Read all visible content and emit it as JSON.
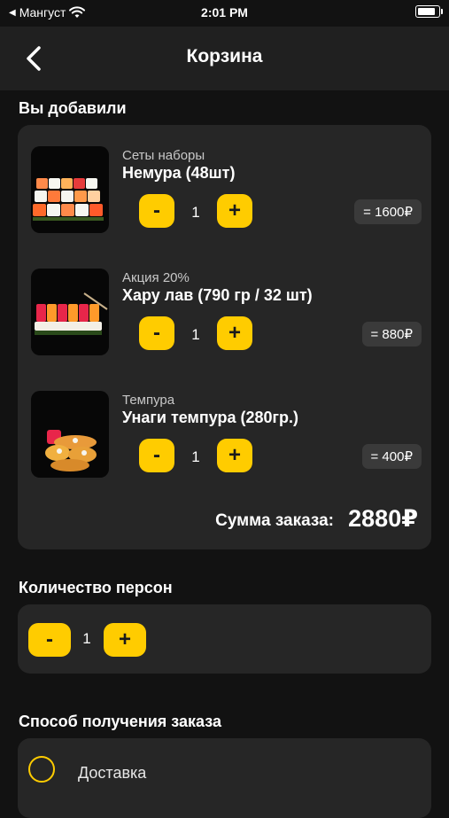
{
  "status_bar": {
    "carrier": "Мангуст",
    "time": "2:01 PM"
  },
  "header": {
    "title": "Корзина"
  },
  "cart": {
    "section_title": "Вы добавили",
    "items": [
      {
        "category": "Сеты наборы",
        "name": "Немура (48шт)",
        "quantity": "1",
        "price": "= 1600₽"
      },
      {
        "category": "Акция 20%",
        "name": "Хару лав (790 гр / 32 шт)",
        "quantity": "1",
        "price": "= 880₽"
      },
      {
        "category": "Темпура",
        "name": "Унаги темпура (280гр.)",
        "quantity": "1",
        "price": "= 400₽"
      }
    ],
    "minus_label": "-",
    "plus_label": "+",
    "total_label": "Сумма заказа:",
    "total_value": "2880₽"
  },
  "persons": {
    "section_title": "Количество персон",
    "value": "1",
    "minus_label": "-",
    "plus_label": "+"
  },
  "delivery": {
    "section_title": "Способ получения заказа",
    "options": [
      "Доставка"
    ]
  },
  "colors": {
    "accent": "#ffcc00",
    "background": "#121212",
    "card": "#262626"
  }
}
